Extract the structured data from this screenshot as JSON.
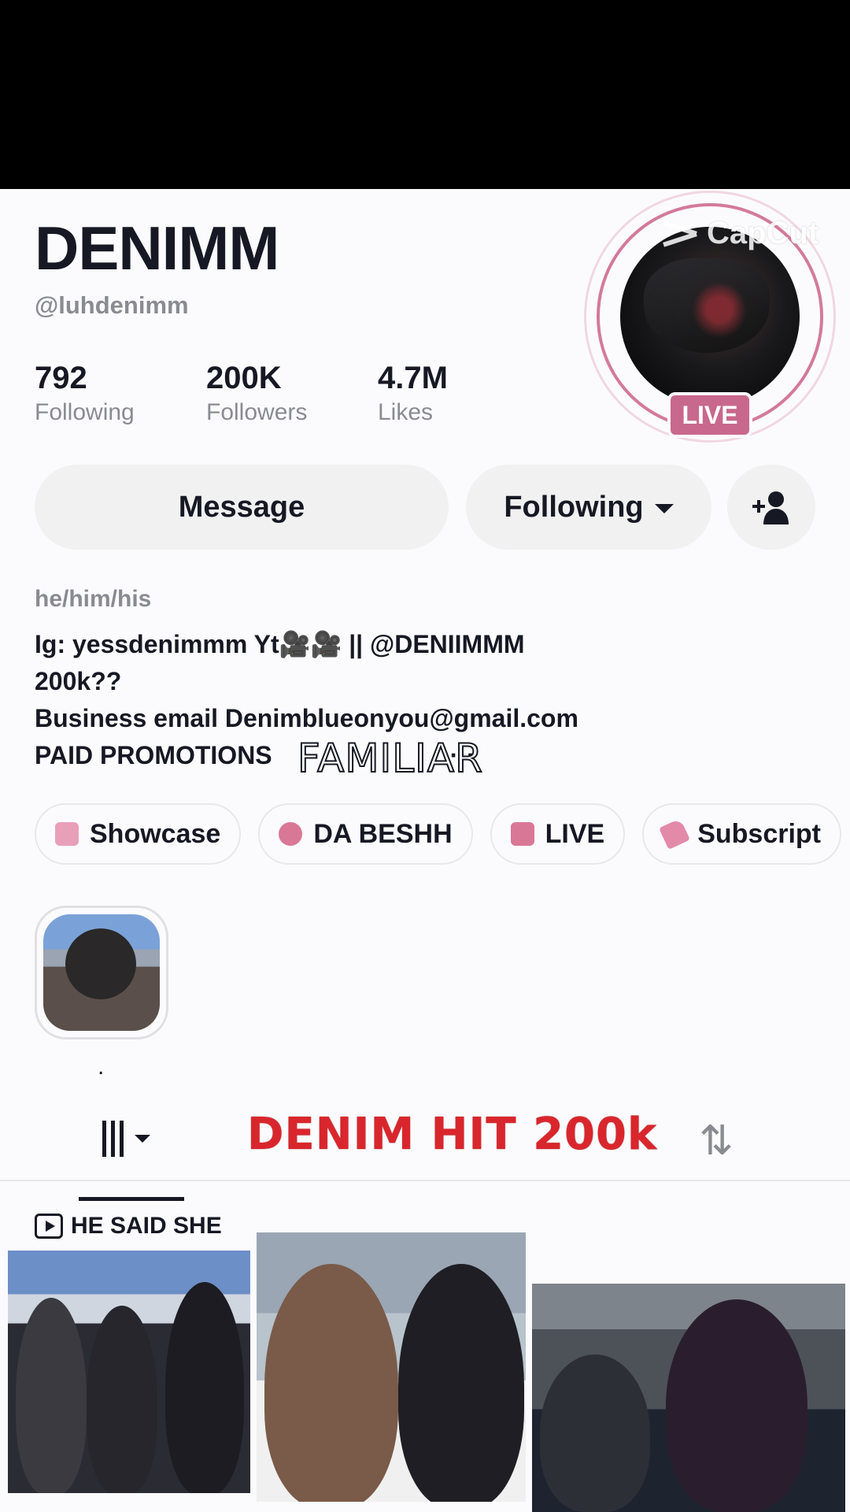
{
  "profile": {
    "display_name": "DENIMM",
    "username": "@luhdenimm",
    "live_badge": "LIVE",
    "stats": [
      {
        "value": "792",
        "label": "Following"
      },
      {
        "value": "200K",
        "label": "Followers"
      },
      {
        "value": "4.7M",
        "label": "Likes"
      }
    ]
  },
  "watermark": {
    "text": "CapCut"
  },
  "actions": {
    "message_label": "Message",
    "following_label": "Following"
  },
  "bio": {
    "pronouns": "he/him/his",
    "lines": [
      "Ig: yessdenimmm Yt🎥🎥 || @DENIIMMM",
      "200k??",
      "Business email Denimblueonyou@gmail.com",
      "PAID PROMOTIONS"
    ],
    "more": "···"
  },
  "links": [
    {
      "label": "Showcase",
      "icon": "shopping-bag-icon"
    },
    {
      "label": "DA BESHH",
      "icon": "chat-bubble-icon"
    },
    {
      "label": "LIVE",
      "icon": "bar-chart-icon"
    },
    {
      "label": "Subscript",
      "icon": "subscription-tag-icon"
    }
  ],
  "highlight": {
    "label": "."
  },
  "overlays": {
    "familiar": "FAMILIAR",
    "hit": "DENIM HIT 200k"
  },
  "pinned_video": {
    "label": "HE SAID SHE"
  },
  "colors": {
    "accent_pink": "#d37a99",
    "live_badge": "#c8688c",
    "overlay_red": "#d9262c",
    "text_primary": "#161823",
    "text_secondary": "#8a8b91"
  }
}
